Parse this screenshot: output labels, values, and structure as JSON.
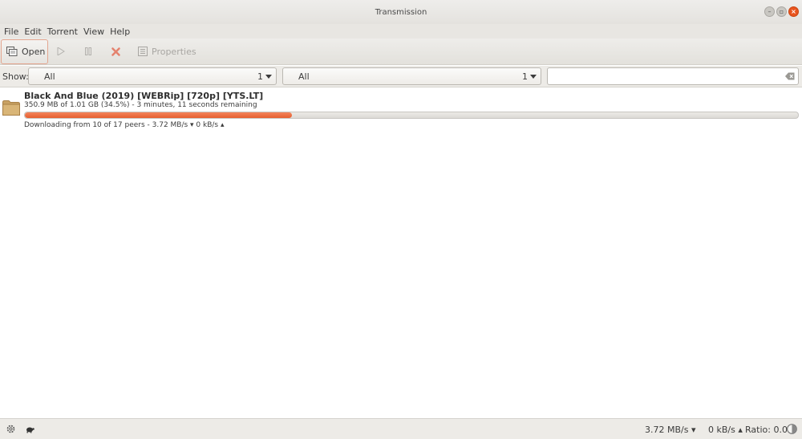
{
  "window": {
    "title": "Transmission"
  },
  "menu": {
    "items": [
      "File",
      "Edit",
      "Torrent",
      "View",
      "Help"
    ]
  },
  "toolbar": {
    "open_label": "Open",
    "properties_label": "Properties",
    "icons": [
      "open-icon",
      "start-icon",
      "pause-icon",
      "remove-icon",
      "properties-icon"
    ]
  },
  "filter": {
    "show_label": "Show:",
    "activity": {
      "value": "All",
      "count": "1"
    },
    "tracker": {
      "value": "All",
      "count": "1"
    },
    "search_placeholder": ""
  },
  "torrents": [
    {
      "name": "Black And Blue (2019) [WEBRip] [720p] [YTS.LT]",
      "progress_text": "350.9 MB of 1.01 GB (34.5%) - 3 minutes, 11 seconds remaining",
      "progress_fraction": 0.345,
      "status": "Downloading from 10 of 17 peers - 3.72 MB/s ▾  0 kB/s ▴",
      "icon": "folder-icon"
    }
  ],
  "statusbar": {
    "down_speed": "3.72 MB/s ▾",
    "up_speed": "0 kB/s ▴",
    "ratio": "Ratio: 0.0"
  },
  "colors": {
    "accent": "#e9541e",
    "progress": "#ec6d42",
    "chrome": "#e8e6e2"
  }
}
